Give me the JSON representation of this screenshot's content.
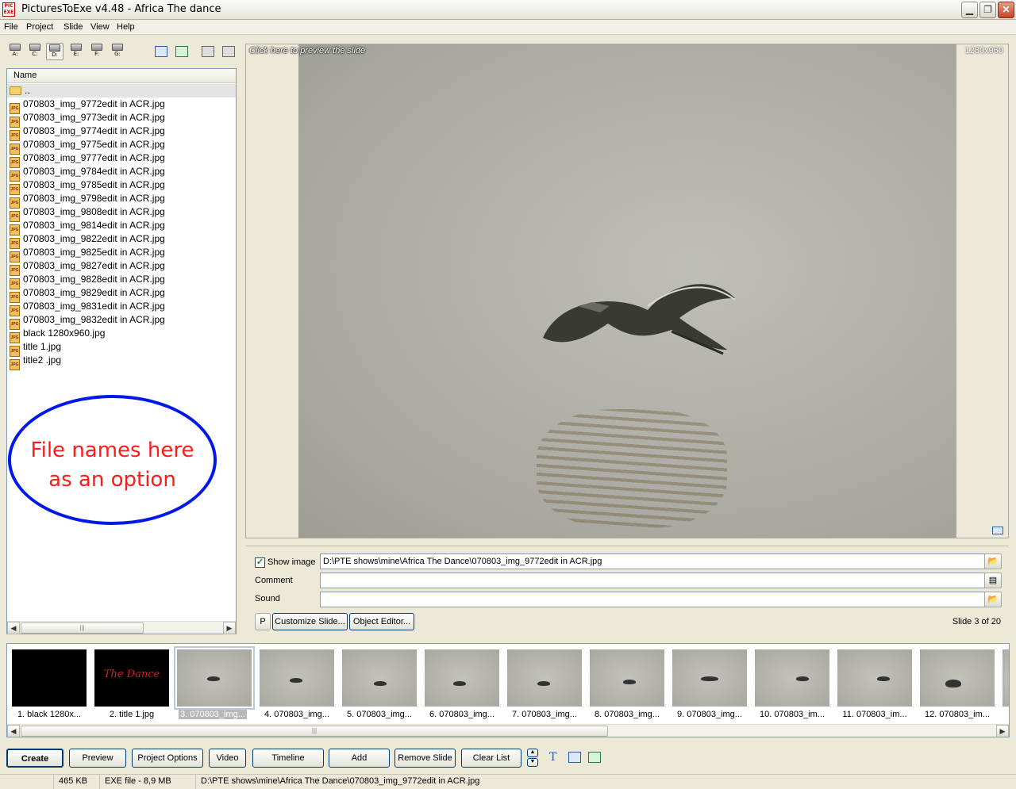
{
  "window": {
    "title": "PicturesToExe v4.48 - Africa The dance",
    "app_icon": "PIC EXE"
  },
  "menu": [
    "File",
    "Project",
    "Slide",
    "View",
    "Help"
  ],
  "drives": [
    {
      "letter": "A:",
      "selected": false
    },
    {
      "letter": "C:",
      "selected": false
    },
    {
      "letter": "D:",
      "selected": true
    },
    {
      "letter": "E:",
      "selected": false
    },
    {
      "letter": "F:",
      "selected": false
    },
    {
      "letter": "G:",
      "selected": false
    }
  ],
  "file_panel": {
    "column_header": "Name",
    "parent_dir": "..",
    "files": [
      "070803_img_9772edit in ACR.jpg",
      "070803_img_9773edit in ACR.jpg",
      "070803_img_9774edit in ACR.jpg",
      "070803_img_9775edit in ACR.jpg",
      "070803_img_9777edit in ACR.jpg",
      "070803_img_9784edit in ACR.jpg",
      "070803_img_9785edit in ACR.jpg",
      "070803_img_9798edit in ACR.jpg",
      "070803_img_9808edit in ACR.jpg",
      "070803_img_9814edit in ACR.jpg",
      "070803_img_9822edit in ACR.jpg",
      "070803_img_9825edit in ACR.jpg",
      "070803_img_9827edit in ACR.jpg",
      "070803_img_9828edit in ACR.jpg",
      "070803_img_9829edit in ACR.jpg",
      "070803_img_9831edit in ACR.jpg",
      "070803_img_9832edit in ACR.jpg",
      "black 1280x960.jpg",
      "title 1.jpg",
      "title2 .jpg"
    ]
  },
  "annotation": {
    "line1": "File names here",
    "line2": "as an option"
  },
  "preview": {
    "hint": "Click here to preview the slide",
    "resolution": "1280x960"
  },
  "slide_props": {
    "show_image_label": "Show image",
    "show_image_checked": true,
    "image_path": "D:\\PTE shows\\mine\\Africa The Dance\\070803_img_9772edit in ACR.jpg",
    "comment_label": "Comment",
    "comment_value": "",
    "sound_label": "Sound",
    "sound_value": "",
    "p_button": "P",
    "customize_button": "Customize Slide...",
    "object_editor_button": "Object Editor...",
    "slide_counter": "Slide 3 of 20"
  },
  "thumbnails": [
    {
      "label": "1. black 1280x...",
      "kind": "black"
    },
    {
      "label": "2. title 1.jpg",
      "kind": "title",
      "overlay": "The Dance"
    },
    {
      "label": "3. 070803_img...",
      "kind": "photo",
      "selected": true
    },
    {
      "label": "4. 070803_img...",
      "kind": "photo"
    },
    {
      "label": "5. 070803_img...",
      "kind": "photo"
    },
    {
      "label": "6. 070803_img...",
      "kind": "photo"
    },
    {
      "label": "7. 070803_img...",
      "kind": "photo"
    },
    {
      "label": "8. 070803_img...",
      "kind": "photo"
    },
    {
      "label": "9. 070803_img...",
      "kind": "photo"
    },
    {
      "label": "10. 070803_im...",
      "kind": "photo"
    },
    {
      "label": "11. 070803_im...",
      "kind": "photo"
    },
    {
      "label": "12. 070803_im...",
      "kind": "photo"
    }
  ],
  "buttons": {
    "create": "Create",
    "preview": "Preview",
    "project_options": "Project Options",
    "video": "Video",
    "timeline": "Timeline",
    "add": "Add",
    "remove_slide": "Remove Slide",
    "clear_list": "Clear List",
    "text_tool": "T"
  },
  "status": {
    "size": "465 KB",
    "exe": "EXE file - 8,9 MB",
    "path": "D:\\PTE shows\\mine\\Africa The Dance\\070803_img_9772edit in ACR.jpg"
  },
  "colors": {
    "callout_border": "#0018e8",
    "callout_text": "#ff1a1a",
    "window_bg": "#ece9d8"
  }
}
